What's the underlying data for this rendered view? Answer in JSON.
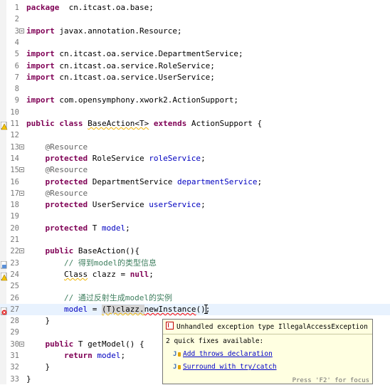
{
  "editor": {
    "lines": [
      {
        "n": "1",
        "fold": false,
        "segs": [
          [
            "kw",
            "package"
          ],
          [
            "",
            "  cn.itcast.oa.base;"
          ]
        ]
      },
      {
        "n": "2",
        "fold": false,
        "segs": []
      },
      {
        "n": "3",
        "fold": true,
        "segs": [
          [
            "kw",
            "import"
          ],
          [
            "",
            " javax.annotation.Resource;"
          ]
        ]
      },
      {
        "n": "4",
        "fold": false,
        "segs": []
      },
      {
        "n": "5",
        "fold": false,
        "segs": [
          [
            "kw",
            "import"
          ],
          [
            "",
            " cn.itcast.oa.service.DepartmentService;"
          ]
        ]
      },
      {
        "n": "6",
        "fold": false,
        "segs": [
          [
            "kw",
            "import"
          ],
          [
            "",
            " cn.itcast.oa.service.RoleService;"
          ]
        ]
      },
      {
        "n": "7",
        "fold": false,
        "segs": [
          [
            "kw",
            "import"
          ],
          [
            "",
            " cn.itcast.oa.service.UserService;"
          ]
        ]
      },
      {
        "n": "8",
        "fold": false,
        "segs": []
      },
      {
        "n": "9",
        "fold": false,
        "segs": [
          [
            "kw",
            "import"
          ],
          [
            "",
            " com.opensymphony.xwork2.ActionSupport;"
          ]
        ]
      },
      {
        "n": "10",
        "fold": false,
        "segs": []
      },
      {
        "n": "11",
        "fold": false,
        "marker": "warning",
        "segs": [
          [
            "kw",
            "public"
          ],
          [
            "",
            " "
          ],
          [
            "kw",
            "class"
          ],
          [
            "",
            " "
          ],
          [
            "warn",
            "BaseAction<T>"
          ],
          [
            "",
            " "
          ],
          [
            "kw",
            "extends"
          ],
          [
            "",
            " ActionSupport {"
          ]
        ]
      },
      {
        "n": "12",
        "fold": false,
        "segs": []
      },
      {
        "n": "13",
        "fold": true,
        "segs": [
          [
            "",
            "    "
          ],
          [
            "ann",
            "@Resource"
          ]
        ]
      },
      {
        "n": "14",
        "fold": false,
        "segs": [
          [
            "",
            "    "
          ],
          [
            "kw",
            "protected"
          ],
          [
            "",
            " RoleService "
          ],
          [
            "fld",
            "roleService"
          ],
          [
            "",
            ";"
          ]
        ]
      },
      {
        "n": "15",
        "fold": true,
        "segs": [
          [
            "",
            "    "
          ],
          [
            "ann",
            "@Resource"
          ]
        ]
      },
      {
        "n": "16",
        "fold": false,
        "segs": [
          [
            "",
            "    "
          ],
          [
            "kw",
            "protected"
          ],
          [
            "",
            " DepartmentService "
          ],
          [
            "fld",
            "departmentService"
          ],
          [
            "",
            ";"
          ]
        ]
      },
      {
        "n": "17",
        "fold": true,
        "segs": [
          [
            "",
            "    "
          ],
          [
            "ann",
            "@Resource"
          ]
        ]
      },
      {
        "n": "18",
        "fold": false,
        "segs": [
          [
            "",
            "    "
          ],
          [
            "kw",
            "protected"
          ],
          [
            "",
            " UserService "
          ],
          [
            "fld",
            "userService"
          ],
          [
            "",
            ";"
          ]
        ]
      },
      {
        "n": "19",
        "fold": false,
        "segs": []
      },
      {
        "n": "20",
        "fold": false,
        "segs": [
          [
            "",
            "    "
          ],
          [
            "kw",
            "protected"
          ],
          [
            "",
            " T "
          ],
          [
            "fld",
            "model"
          ],
          [
            "",
            ";"
          ]
        ]
      },
      {
        "n": "21",
        "fold": false,
        "segs": []
      },
      {
        "n": "22",
        "fold": true,
        "segs": [
          [
            "",
            "    "
          ],
          [
            "kw",
            "public"
          ],
          [
            "",
            " BaseAction(){"
          ]
        ]
      },
      {
        "n": "23",
        "fold": false,
        "marker": "task",
        "segs": [
          [
            "",
            "        "
          ],
          [
            "cmt",
            "// 得到model的类型信息"
          ]
        ]
      },
      {
        "n": "24",
        "fold": false,
        "marker": "warning",
        "segs": [
          [
            "",
            "        "
          ],
          [
            "warn",
            "Class"
          ],
          [
            "",
            " clazz = "
          ],
          [
            "kw",
            "null"
          ],
          [
            "",
            ";"
          ]
        ]
      },
      {
        "n": "25",
        "fold": false,
        "segs": []
      },
      {
        "n": "26",
        "fold": false,
        "segs": [
          [
            "",
            "        "
          ],
          [
            "cmt",
            "// 通过反射生成model的实例"
          ]
        ]
      },
      {
        "n": "27",
        "fold": false,
        "marker": "error",
        "current": true,
        "segs": [
          [
            "",
            "        "
          ],
          [
            "fld",
            "model"
          ],
          [
            "",
            " = "
          ],
          [
            "warn",
            "(T)clazz."
          ],
          [
            "err",
            "newInstance"
          ],
          [
            "",
            "();"
          ]
        ]
      },
      {
        "n": "28",
        "fold": false,
        "segs": [
          [
            "",
            "    }"
          ]
        ]
      },
      {
        "n": "29",
        "fold": false,
        "segs": []
      },
      {
        "n": "30",
        "fold": true,
        "segs": [
          [
            "",
            "    "
          ],
          [
            "kw",
            "public"
          ],
          [
            "",
            " T getModel() {"
          ]
        ]
      },
      {
        "n": "31",
        "fold": false,
        "segs": [
          [
            "",
            "        "
          ],
          [
            "kw",
            "return"
          ],
          [
            "",
            " "
          ],
          [
            "fld",
            "model"
          ],
          [
            "",
            ";"
          ]
        ]
      },
      {
        "n": "32",
        "fold": false,
        "segs": [
          [
            "",
            "    }"
          ]
        ]
      },
      {
        "n": "33",
        "fold": false,
        "segs": [
          [
            "",
            "}"
          ]
        ]
      }
    ]
  },
  "popup": {
    "title": "Unhandled exception type IllegalAccessException",
    "subtitle": "2 quick fixes available:",
    "fixes": [
      {
        "label": "Add throws declaration"
      },
      {
        "label": "Surround with try/catch"
      }
    ],
    "hint": "Press 'F2' for focus"
  },
  "colors": {
    "keyword": "#7f0055",
    "annotation": "#646464",
    "field": "#0000c0",
    "comment": "#3f7f5f",
    "popup_bg": "#ffffe1",
    "current_line": "#e8f2fe"
  }
}
